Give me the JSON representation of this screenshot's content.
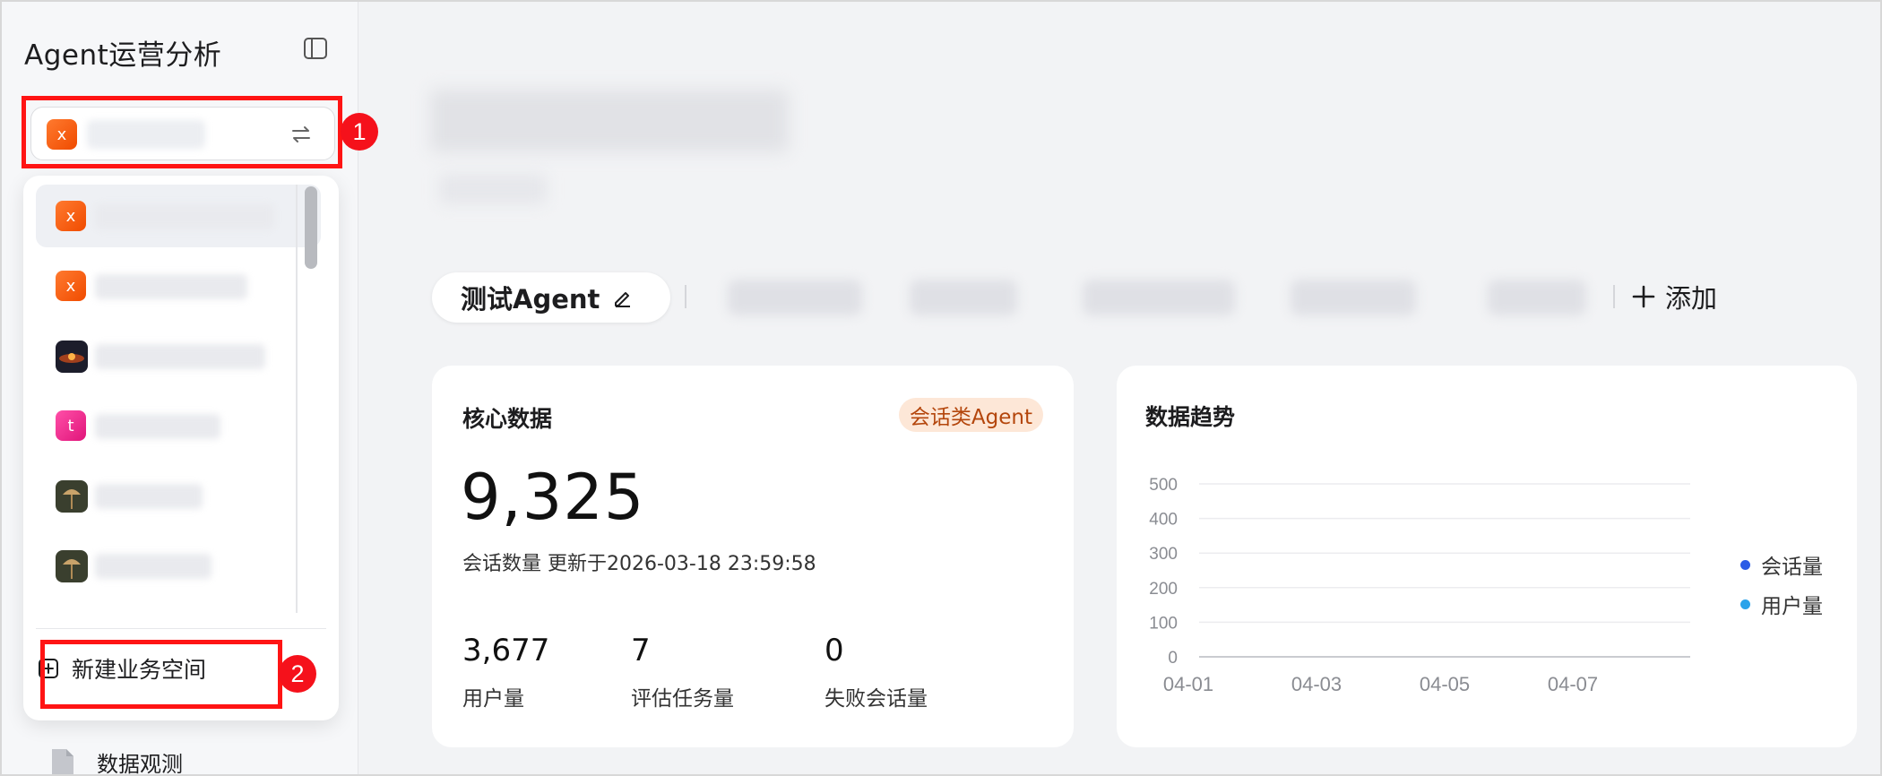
{
  "sidebar": {
    "app_title": "Agent运营分析",
    "current_workspace_badge": "x",
    "workspaces": [
      {
        "badge": "x",
        "type": "letter",
        "color": "#f25c0f"
      },
      {
        "badge": "x",
        "type": "letter",
        "color": "#f25c0f"
      },
      {
        "badge": "",
        "type": "photo"
      },
      {
        "badge": "t",
        "type": "letter",
        "color": "#e91e8a"
      },
      {
        "badge": "",
        "type": "photo"
      },
      {
        "badge": "",
        "type": "photo"
      }
    ],
    "new_workspace_label": "新建业务空间",
    "nav_items": [
      {
        "label": "数据观测"
      }
    ]
  },
  "callouts": {
    "first": "1",
    "second": "2"
  },
  "tabs": {
    "active_label": "测试Agent",
    "add_label": "添加"
  },
  "core_card": {
    "title": "核心数据",
    "tag": "会话类Agent",
    "big_number": "9,325",
    "subtitle": "会话数量 更新于2026-03-18 23:59:58",
    "metrics": [
      {
        "value": "3,677",
        "label": "用户量"
      },
      {
        "value": "7",
        "label": "评估任务量"
      },
      {
        "value": "0",
        "label": "失败会话量"
      }
    ]
  },
  "trend_card": {
    "title": "数据趋势"
  },
  "chart_data": {
    "type": "line",
    "x_ticks": [
      "04-01",
      "04-03",
      "04-05",
      "04-07"
    ],
    "y_ticks": [
      0,
      100,
      200,
      300,
      400,
      500
    ],
    "ylim": [
      0,
      500
    ],
    "grid": true,
    "legend_position": "right",
    "series": [
      {
        "name": "会话量",
        "color": "#2b5ce6",
        "values": []
      },
      {
        "name": "用户量",
        "color": "#2aa3ea",
        "values": []
      }
    ]
  },
  "colors": {
    "accent_orange": "#f25c0f",
    "highlight_red": "#ff1414",
    "tag_bg": "#fde7d7",
    "tag_text": "#b4460c"
  }
}
